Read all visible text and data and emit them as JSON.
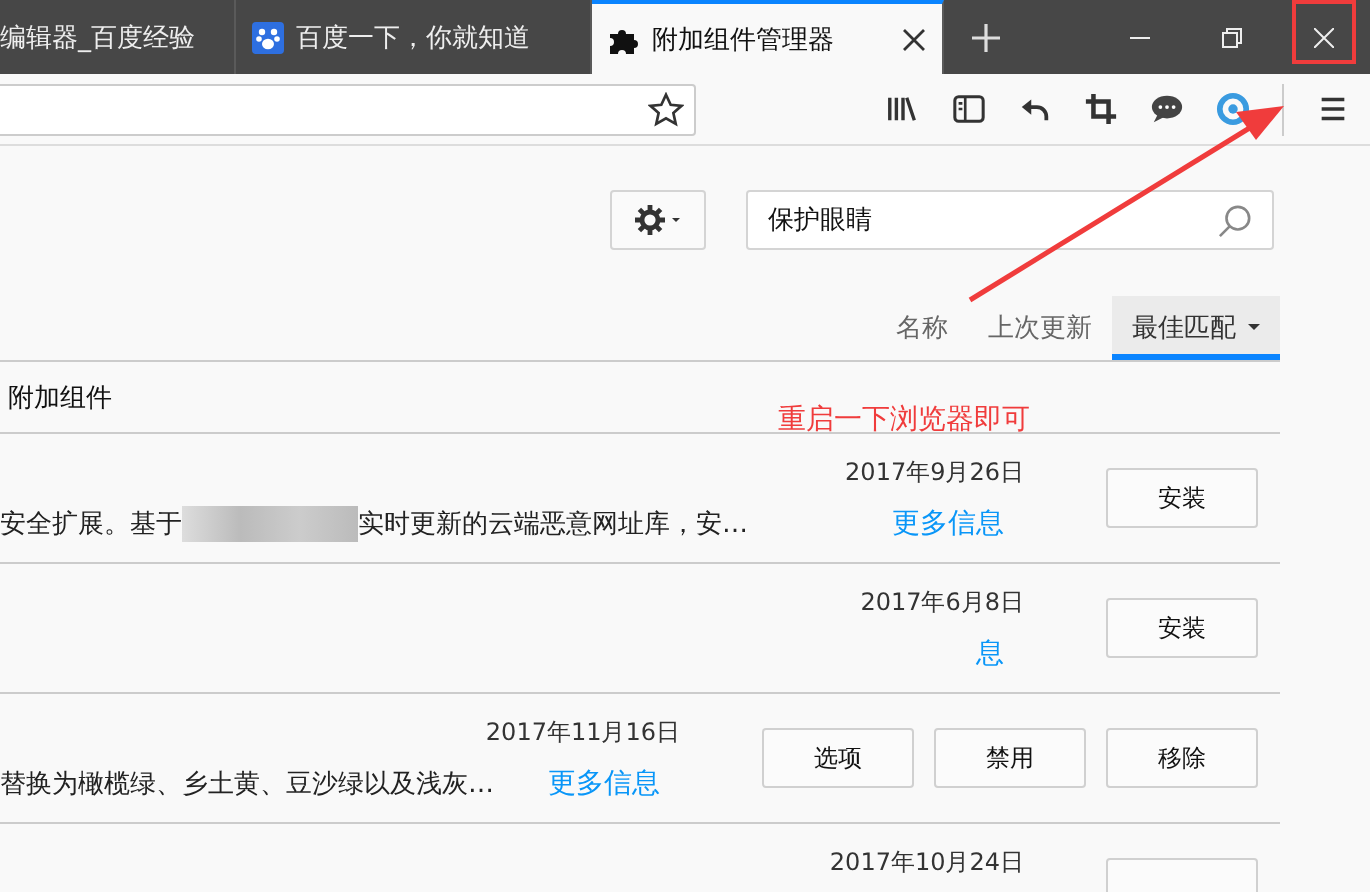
{
  "tabs": [
    {
      "title": "编辑器_百度经验",
      "kind": "plain",
      "selected": false
    },
    {
      "title": "百度一下，你就知道",
      "kind": "paw",
      "selected": false
    },
    {
      "title": "附加组件管理器",
      "kind": "puzzle",
      "selected": true
    }
  ],
  "search": {
    "value": "保护眼睛"
  },
  "sort_tabs": [
    {
      "label": "名称",
      "selected": false
    },
    {
      "label": "上次更新",
      "selected": false
    },
    {
      "label": "最佳匹配",
      "selected": true
    }
  ],
  "section_heading": "附加组件",
  "rows": [
    {
      "date": "2017年9月26日",
      "description_start": "安全扩展。基于",
      "description_end": "实时更新的云端恶意网址库，安…",
      "blurred": true,
      "more_info": "更多信息",
      "buttons": [
        "安装"
      ]
    },
    {
      "date": "2017年6月8日",
      "more_info": "息",
      "buttons": [
        "安装"
      ]
    },
    {
      "date": "2017年11月16日",
      "description_start": "替换为橄榄绿、乡土黄、豆沙绿以及浅灰…",
      "blurred": false,
      "more_info": "更多信息",
      "buttons": [
        "选项",
        "禁用",
        "移除"
      ]
    },
    {
      "date": "2017年10月24日",
      "partial_button": true
    }
  ],
  "annotation": {
    "text": "重启一下浏览器即可"
  }
}
